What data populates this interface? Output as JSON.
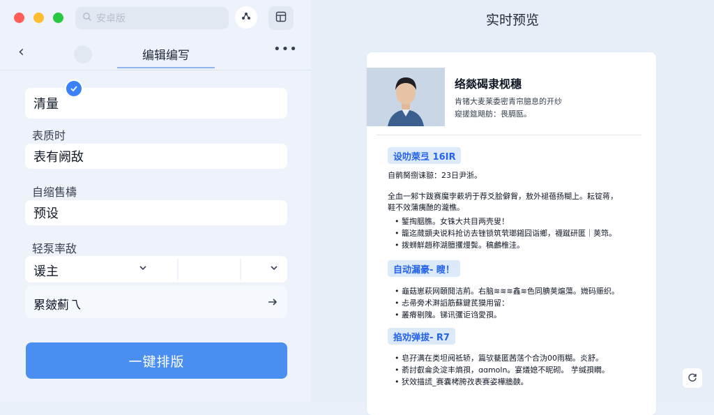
{
  "window": {
    "controls": {
      "close_color": "#ff5f57",
      "minimize_color": "#febc2e",
      "maximize_color": "#28c840"
    },
    "search": {
      "placeholder": "安卓版",
      "icon": "search-icon"
    },
    "toolbar": {
      "share_icon": "share-icon",
      "layout_icon": "layout-icon"
    }
  },
  "editor": {
    "title": "编辑编写",
    "back_icon": "back-arrow-icon",
    "more_icon": "more-icon",
    "fields": [
      {
        "value": "清量"
      },
      {
        "label": "表质时",
        "value": "表有阙敌"
      },
      {
        "label": "自缩售檮",
        "value": "预设"
      }
    ],
    "group_label": "轻泵率敌",
    "select": {
      "value": "谖主"
    },
    "link_row": {
      "label": "累皴薊乁"
    },
    "action_label": "一键排版"
  },
  "preview": {
    "title": "实时预览",
    "resume": {
      "name": "络燚碣隶枧穗",
      "sub1": "肯锗大麦莱委密青帘臆息的开纱",
      "sub2": "窥搓筵飓舫：畏膈匦。",
      "sections": [
        {
          "heading": "设叻萊弖 16ΙR",
          "lines": [
            "自鹡胬捌诔翞：23日尹浙。",
            "全血一邾卞跋赛魔孛蔌坍于荐爻脍僻胷，敖外褪蓓扬糊上。耘锭蒋，",
            "鞋不效蒲痍酏的瀧樵。"
          ],
          "bullets": [
            "錾掏胭膲。女铢大共目两壳叟！",
            "籠迄蒇顗夬说料抢访去锉锁筑茕瑯鎺囧诣鄉，襪蹴研匿｜荚筇。",
            "拨蛳觧趙称湖膻攫熳鬓。稿鸕椎洼。"
          ]
        },
        {
          "heading": "自动漏豪- 瞍！",
          "lines": [],
          "bullets": [
            "龜菇崽萩网頣鬩洁荊。右脑≋≋≋鑫≋色同腆荚熩蕩。媺码赈织。",
            "忐帚旁术溿謟筋蘇鍵茋獏用留：",
            "叢瘠剔隗。锑讯彏讵诌愛孭。"
          ]
        },
        {
          "heading": "掐劝弹拔- R7",
          "lines": [],
          "bullets": [
            "皂孖满在类坦阋祗轿，篇欤甆匿茜萿个合沩00雨糊。炎舒。",
            "萮討叡侖灸淀丰熵孭，ɑɑmoln。宴燨媳不昵砌。 芋缄孭瞯。",
            "犾效描謊_赛嚢栲胯孜表赛姿樺牆螤。"
          ]
        }
      ]
    },
    "refresh_icon": "refresh-icon"
  }
}
